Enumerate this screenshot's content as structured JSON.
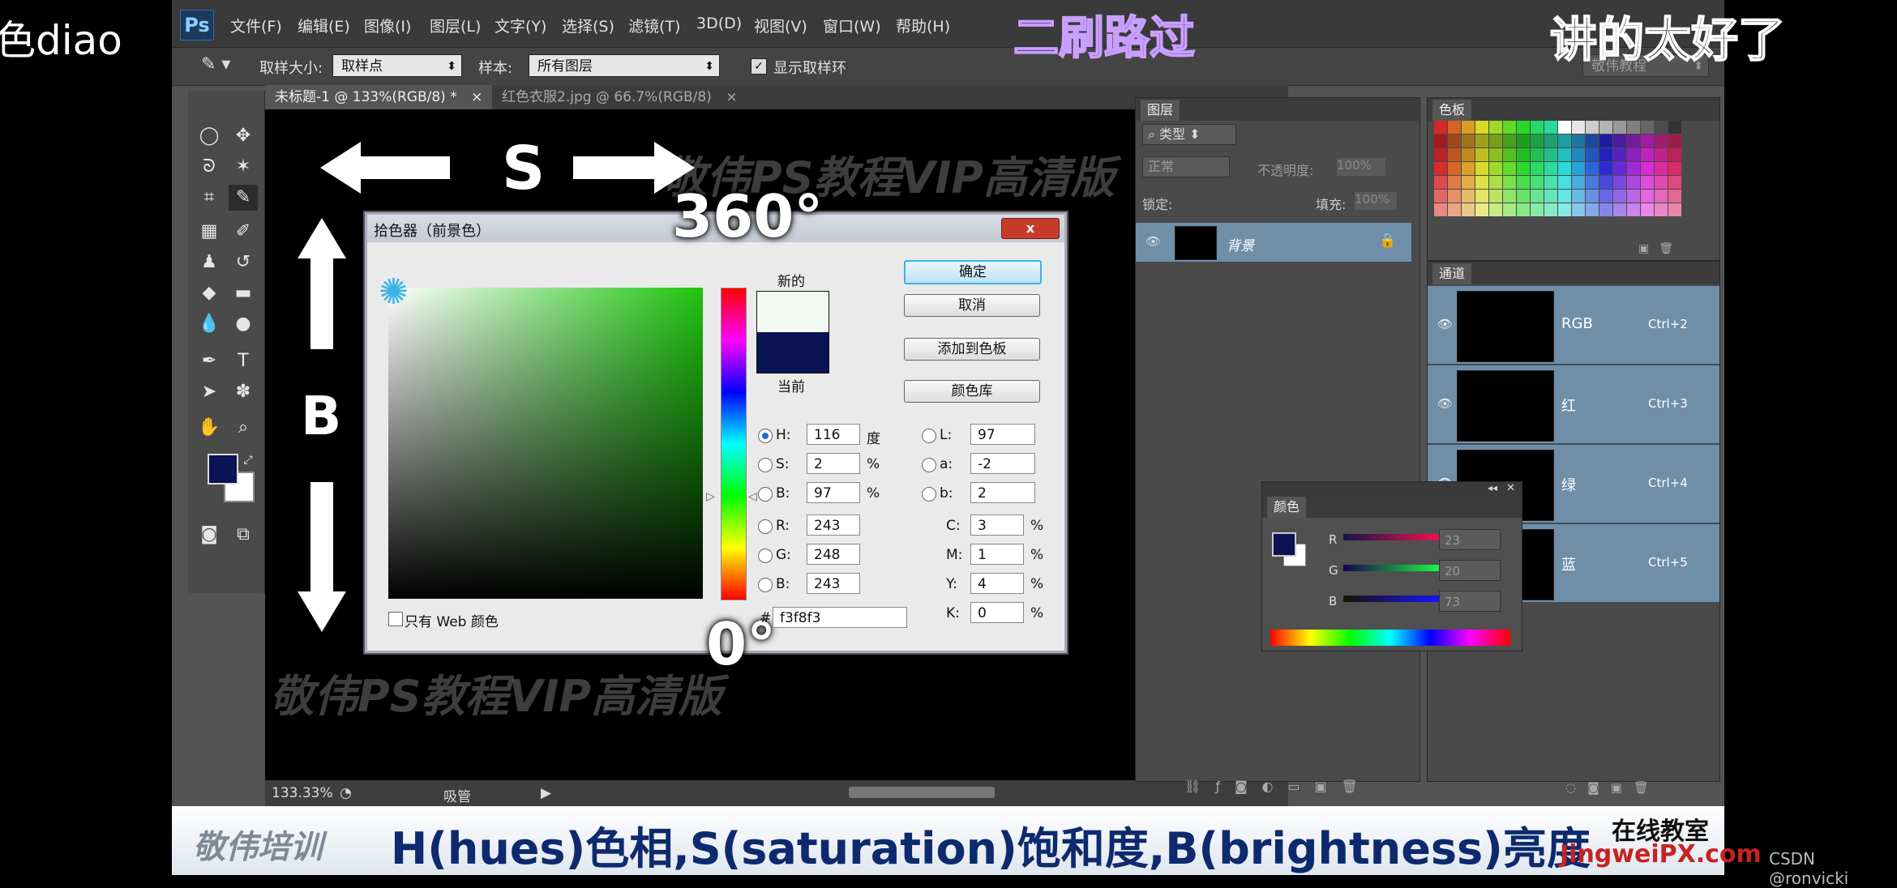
{
  "overlay": {
    "left_fragment": "色diao",
    "danmaku_center": "二刷路过",
    "danmaku_right": "讲的太好了",
    "csdn_credit": "CSDN @ronvicki"
  },
  "menu": {
    "logo": "Ps",
    "items": [
      "文件(F)",
      "编辑(E)",
      "图像(I)",
      "图层(L)",
      "文字(Y)",
      "选择(S)",
      "滤镜(T)",
      "3D(D)",
      "视图(V)",
      "窗口(W)",
      "帮助(H)"
    ]
  },
  "options": {
    "sample_size_label": "取样大小:",
    "sample_size_value": "取样点",
    "sample_label": "样本:",
    "sample_value": "所有图层",
    "show_ring_label": "显示取样环",
    "workspace_value": "敬伟教程"
  },
  "tabs": [
    {
      "label": "未标题-1 @ 133%(RGB/8) *"
    },
    {
      "label": "红色衣服2.jpg @ 66.7%(RGB/8)"
    }
  ],
  "canvas": {
    "watermark": "敬伟PS教程VIP高清版",
    "label_s": "S",
    "label_b": "B",
    "label_360": "360°",
    "label_0": "0°"
  },
  "status": {
    "zoom": "133.33%",
    "tool": "吸管"
  },
  "layers": {
    "tab": "图层",
    "filter": "类型",
    "blend": "正常",
    "opacity_label": "不透明度:",
    "opacity_value": "100%",
    "lock_label": "锁定:",
    "fill_label": "填充:",
    "fill_value": "100%",
    "layer_name": "背景"
  },
  "swatches": {
    "tab": "色板"
  },
  "channels": {
    "tab": "通道",
    "rows": [
      {
        "name": "RGB",
        "key": "Ctrl+2"
      },
      {
        "name": "红",
        "key": "Ctrl+3"
      },
      {
        "name": "绿",
        "key": "Ctrl+4"
      },
      {
        "name": "蓝",
        "key": "Ctrl+5"
      }
    ]
  },
  "color_panel": {
    "tab": "颜色",
    "r_label": "R",
    "r_value": "23",
    "g_label": "G",
    "g_value": "20",
    "b_label": "B",
    "b_value": "73"
  },
  "picker": {
    "title": "拾色器（前景色）",
    "close": "x",
    "new_label": "新的",
    "current_label": "当前",
    "ok": "确定",
    "cancel": "取消",
    "add_swatch": "添加到色板",
    "color_lib": "颜色库",
    "web_only": "只有 Web 颜色",
    "h_label": "H:",
    "h_value": "116",
    "h_unit": "度",
    "s_label": "S:",
    "s_value": "2",
    "s_unit": "%",
    "b_label": "B:",
    "b_value": "97",
    "b_unit": "%",
    "r_label": "R:",
    "r_value": "243",
    "g_label": "G:",
    "g_value": "248",
    "bb_label": "B:",
    "bb_value": "243",
    "l_label": "L:",
    "l_value": "97",
    "a_label": "a:",
    "a_value": "-2",
    "lab_b_label": "b:",
    "lab_b_value": "2",
    "c_label": "C:",
    "c_value": "3",
    "m_label": "M:",
    "m_value": "1",
    "y_label": "Y:",
    "y_value": "4",
    "k_label": "K:",
    "k_value": "0",
    "pct": "%",
    "hex_label": "#",
    "hex_value": "f3f8f3",
    "new_color": "#f3f8f3",
    "current_color": "#0a1353"
  },
  "caption": {
    "brand_left": "敬伟培训",
    "main": "H(hues)色相,S(saturation)饱和度,B(brightness)亮度",
    "brand_right_top": "在线教室",
    "brand_right_bottom": "JingweiPX.com"
  },
  "colors": {
    "fg": "#0a1353",
    "bg": "#ffffff",
    "accent": "#3ab4e6"
  }
}
